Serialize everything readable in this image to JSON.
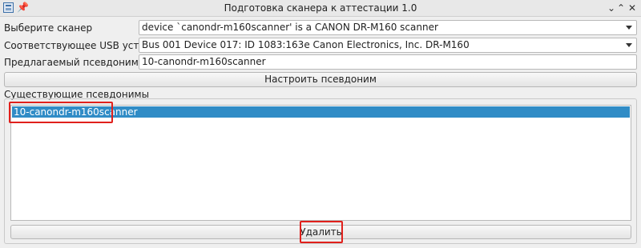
{
  "window": {
    "title": "Подготовка сканера к аттестации 1.0",
    "app_icon": "scanner-app-icon",
    "pin_glyph": "📌",
    "minimize_glyph": "⌄",
    "maximize_glyph": "⌃",
    "close_glyph": "✕"
  },
  "form": {
    "scanner_label": "Выберите сканер",
    "scanner_value": "device `canondr-m160scanner' is a CANON DR-M160 scanner",
    "usb_label": "Соответствующее USB устройство",
    "usb_value": "Bus 001 Device 017: ID 1083:163e Canon Electronics, Inc. DR-M160",
    "alias_label": "Предлагаемый псевдоним",
    "alias_value": "10-canondr-m160scanner",
    "configure_button": "Настроить псевдоним"
  },
  "existing": {
    "label": "Существующие псевдонимы",
    "items": [
      "10-canondr-m160scanner"
    ],
    "delete_button": "Удалить"
  },
  "colors": {
    "selection": "#308cc6",
    "highlight_box": "#e0201c"
  }
}
